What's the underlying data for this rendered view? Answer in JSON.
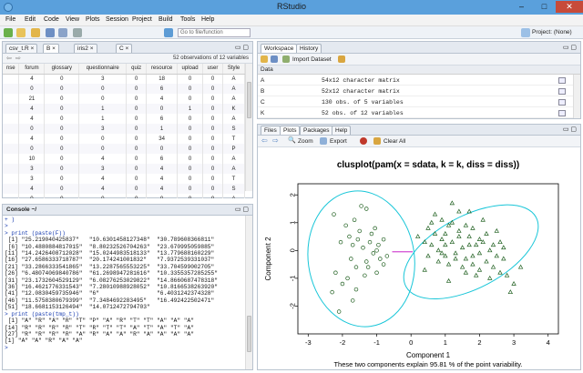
{
  "window": {
    "title": "RStudio",
    "minimize": "–",
    "maximize": "□",
    "close": "✕"
  },
  "menu": [
    "File",
    "Edit",
    "Code",
    "View",
    "Plots",
    "Session",
    "Project",
    "Build",
    "Tools",
    "Help"
  ],
  "toolbar": {
    "goto_placeholder": "Go to file/function",
    "project_label": "Project: (None)"
  },
  "source": {
    "tabs": [
      "csv_t.R",
      "B",
      "iris2",
      "C"
    ],
    "obs_label": "52 observations of 12 variables",
    "columns": [
      "nse",
      "forum",
      "glossary",
      "questionnaire",
      "quiz",
      "resource",
      "upload",
      "user",
      "Style"
    ],
    "rows": [
      [
        "4",
        "0",
        "3",
        "0",
        "18",
        "0",
        "0",
        "A"
      ],
      [
        "0",
        "0",
        "0",
        "0",
        "6",
        "0",
        "0",
        "A"
      ],
      [
        "21",
        "0",
        "0",
        "0",
        "4",
        "0",
        "0",
        "A"
      ],
      [
        "4",
        "0",
        "1",
        "0",
        "0",
        "1",
        "0",
        "K"
      ],
      [
        "4",
        "0",
        "1",
        "0",
        "6",
        "0",
        "0",
        "A"
      ],
      [
        "0",
        "0",
        "3",
        "0",
        "1",
        "0",
        "0",
        "S"
      ],
      [
        "4",
        "0",
        "0",
        "0",
        "34",
        "0",
        "0",
        "T"
      ],
      [
        "0",
        "0",
        "0",
        "0",
        "0",
        "0",
        "0",
        "P"
      ],
      [
        "10",
        "0",
        "4",
        "0",
        "6",
        "0",
        "0",
        "A"
      ],
      [
        "3",
        "0",
        "3",
        "0",
        "4",
        "0",
        "0",
        "A"
      ],
      [
        "3",
        "0",
        "4",
        "0",
        "4",
        "0",
        "0",
        "T"
      ],
      [
        "4",
        "0",
        "4",
        "0",
        "4",
        "0",
        "0",
        "S"
      ],
      [
        "0",
        "0",
        "0",
        "0",
        "0",
        "0",
        "0",
        "A"
      ]
    ]
  },
  "console": {
    "tab": "Console ~/",
    "lines": [
      {
        "t": "+ )",
        "o": false
      },
      {
        "t": ">",
        "o": false
      },
      {
        "t": "> print (paste(F))",
        "o": false
      },
      {
        "t": " [1] \"25.219040425837\"   \"10.6301458127348\"  \"30.789608366811\"",
        "o": true
      },
      {
        "t": " [6] \"10.4880884817015\"  \"8.80232526704263\"  \"23.670995059885\"",
        "o": true
      },
      {
        "t": "[11] \"14.2426408712028\"  \"15.0244983518133\"  \"13.779688160229\"",
        "o": true
      },
      {
        "t": "[16] \"27.6586333718787\"  \"20.174241001832\"   \"7.9372539331037\"",
        "o": true
      },
      {
        "t": "[21] \"33.2866333541865\"  \"13.2287565553225\"  \"33.704599002705\"",
        "o": true
      },
      {
        "t": "[26] \"6.48074069840786\"  \"61.2698947281616\"  \"10.3355357285255\"",
        "o": true
      },
      {
        "t": "[31] \"23.1732604529129\"  \"6.08276253029822\"  \"14.8660687478318\"",
        "o": true
      },
      {
        "t": "[36] \"16.4621776331543\"  \"7.28010988928052\"  \"10.8166538263920\"",
        "o": true
      },
      {
        "t": "[41] \"12.0830459735946\"  \"6\"                 \"6.4031242374328\"",
        "o": true
      },
      {
        "t": "[46] \"11.5758380679399\"  \"7.3484692283495\"   \"16.492422502471\"",
        "o": true
      },
      {
        "t": "[51] \"18.6681153126494\"  \"14.0712472794703\"",
        "o": true
      },
      {
        "t": "> print (paste(tmp_t))",
        "o": false
      },
      {
        "t": " [1] \"A\" \"R\" \"A\" \"R\" \"T\" \"P\" \"A\" \"R\" \"T\" \"T\" \"A\" \"A\" \"A\"",
        "o": true
      },
      {
        "t": "[14] \"R\" \"R\" \"R\" \"R\" \"T\" \"R\" \"T\" \"T\" \"A\" \"T\" \"A\" \"T\" \"A\"",
        "o": true
      },
      {
        "t": "[27] \"R\" \"R\" \"R\" \"R\" \"A\" \"R\" \"A\" \"A\" \"R\" \"A\" \"A\" \"A\" \"A\"",
        "o": true
      },
      {
        "t": "[1] \"A\" \"A\" \"R\" \"A\" \"A\"",
        "o": true
      },
      {
        "t": ">",
        "o": false
      }
    ]
  },
  "workspace": {
    "tabs": [
      "Workspace",
      "History"
    ],
    "import_label": "Import Dataset",
    "header": "Data",
    "rows": [
      {
        "name": "A",
        "value": "54x12 character matrix"
      },
      {
        "name": "B",
        "value": "52x12 character matrix"
      },
      {
        "name": "C",
        "value": "130 obs. of 5 variables"
      },
      {
        "name": "K",
        "value": "52 obs. of 12 variables"
      }
    ]
  },
  "files": {
    "tabs": [
      "Files",
      "Plots",
      "Packages",
      "Help"
    ],
    "zoom_label": "Zoom",
    "export_label": "Export",
    "clear_label": "Clear All"
  },
  "chart_data": {
    "type": "scatter",
    "title": "clusplot(pam(x = sdata, k = k, diss = diss))",
    "xlabel": "Component 1",
    "ylabel": "Component 2",
    "subtitle": "These two components explain 95.81 % of the point variability.",
    "xlim": [
      -3.3,
      4.3
    ],
    "ylim": [
      -3.0,
      2.4
    ],
    "x_ticks": [
      -3,
      -2,
      -1,
      0,
      1,
      2,
      3,
      4
    ],
    "y_ticks": [
      -2,
      -1,
      0,
      1,
      2
    ],
    "ellipses": [
      {
        "cx": -1.45,
        "cy": -0.3,
        "rx": 1.55,
        "ry": 2.45,
        "angle": -8
      },
      {
        "cx": 1.75,
        "cy": -0.05,
        "rx": 2.15,
        "ry": 1.3,
        "angle": -28
      }
    ],
    "series": [
      {
        "marker": "circle",
        "color": "#1f5f1f",
        "x": [
          -2.3,
          -2.1,
          -2.0,
          -1.9,
          -1.8,
          -1.7,
          -1.6,
          -1.5,
          -1.4,
          -1.3,
          -1.2,
          -1.1,
          -1.0,
          -0.9,
          -0.8,
          -0.7,
          -2.2,
          -1.75,
          -1.55,
          -1.35,
          -1.15,
          -0.95,
          -2.05,
          -1.85,
          -1.65,
          -1.45,
          -1.25,
          -1.05,
          -1.6,
          -1.0,
          -2.25,
          -1.3,
          -0.8,
          -1.7
        ],
        "y": [
          -1.5,
          -2.2,
          -1.2,
          0.9,
          0.5,
          0.2,
          -0.6,
          0.7,
          0.1,
          -0.4,
          0.3,
          -0.1,
          0.0,
          -0.3,
          -0.5,
          -0.2,
          -0.8,
          -0.3,
          0.4,
          -0.9,
          0.6,
          0.2,
          0.3,
          -1.0,
          1.1,
          1.6,
          -0.6,
          0.8,
          -1.4,
          -0.8,
          1.3,
          1.5,
          0.4,
          -1.8
        ]
      },
      {
        "marker": "triangle",
        "color": "#1f5f1f",
        "x": [
          0.2,
          0.4,
          0.5,
          0.6,
          0.7,
          0.8,
          0.9,
          1.0,
          1.1,
          1.2,
          1.3,
          1.4,
          1.5,
          1.6,
          1.7,
          1.8,
          1.9,
          2.0,
          2.1,
          2.2,
          2.3,
          2.4,
          2.5,
          2.6,
          2.7,
          2.8,
          3.0,
          3.2,
          0.5,
          0.8,
          1.0,
          1.2,
          1.4,
          1.6,
          1.8,
          2.0,
          2.2,
          2.4,
          0.7,
          1.1,
          1.5,
          1.9,
          2.3,
          2.7,
          0.9,
          1.3,
          1.7,
          2.1,
          2.5,
          1.0,
          1.4,
          1.8,
          0.6,
          1.6,
          2.9,
          0.9,
          1.2,
          1.7,
          2.0,
          0.4,
          1.1,
          2.6
        ],
        "y": [
          0.5,
          0.3,
          0.8,
          0.2,
          0.6,
          0.0,
          0.4,
          -0.2,
          0.9,
          0.3,
          -0.1,
          0.7,
          0.1,
          -0.3,
          0.5,
          -0.5,
          0.2,
          -0.1,
          0.3,
          -0.4,
          0.0,
          -0.6,
          -0.2,
          -0.8,
          -0.3,
          -0.9,
          -1.2,
          -0.6,
          -0.2,
          -0.4,
          0.6,
          1.0,
          0.5,
          0.9,
          0.8,
          0.4,
          0.6,
          0.2,
          1.3,
          -0.5,
          -0.6,
          -0.9,
          -1.0,
          0.1,
          1.1,
          -0.3,
          0.2,
          1.1,
          0.7,
          0.2,
          1.4,
          -0.2,
          1.0,
          -0.8,
          -1.5,
          -0.1,
          1.7,
          1.4,
          -0.7,
          -0.7,
          -1.1,
          0.3
        ]
      }
    ],
    "connector": {
      "x1": -0.55,
      "y1": -0.05,
      "x2": 0.05,
      "y2": -0.05,
      "color": "#c000c0"
    }
  }
}
